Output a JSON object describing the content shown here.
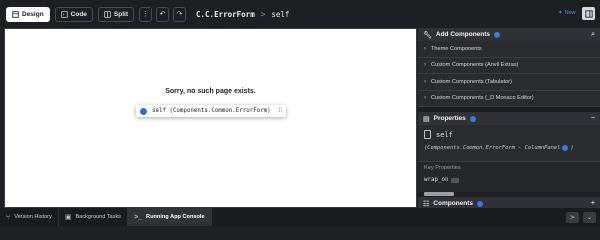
{
  "toolbar": {
    "design_label": "Design",
    "code_label": "Code",
    "split_label": "Split",
    "breadcrumb_form": "C.C.ErrorForm",
    "breadcrumb_sep": ">",
    "breadcrumb_self": "self",
    "new_label": "New"
  },
  "canvas": {
    "message": "Sorry, no such page exists.",
    "component_label": "self (Components.Common.ErrorForm)"
  },
  "add_components": {
    "title": "Add Components",
    "items": [
      "Theme Components",
      "Custom Components (Anvil Extras)",
      "Custom Components (Tabulator)",
      "Custom Components (_D Monaco Editor)"
    ]
  },
  "properties": {
    "title": "Properties",
    "name": "self",
    "type": "(Components.Common.ErrorForm - ColumnPanel",
    "type_end": ")",
    "key_properties_label": "Key Properties",
    "wrap_on": "wrap_on"
  },
  "components_panel": {
    "title": "Components"
  },
  "bottom_tabs": {
    "version_history": "Version History",
    "background_tasks": "Background Tasks",
    "app_console": "Running App Console"
  },
  "colors": {
    "accent": "#3a7bd5",
    "canvas_bg": "#ffffff",
    "panel_bg": "#2a2b2f"
  },
  "icons": [
    "design-icon",
    "code-icon",
    "split-icon",
    "more-icon",
    "undo-icon",
    "redo-icon",
    "panel-toggle-icon",
    "search-icon",
    "collapse-icon",
    "expand-icon",
    "terminal-icon",
    "chevron-down-icon"
  ]
}
